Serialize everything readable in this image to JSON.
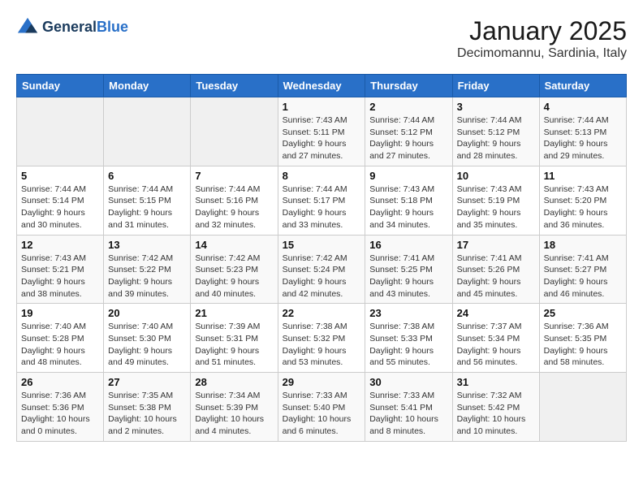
{
  "header": {
    "logo_line1": "General",
    "logo_line2": "Blue",
    "month": "January 2025",
    "location": "Decimomannu, Sardinia, Italy"
  },
  "weekdays": [
    "Sunday",
    "Monday",
    "Tuesday",
    "Wednesday",
    "Thursday",
    "Friday",
    "Saturday"
  ],
  "rows": [
    [
      {
        "day": "",
        "info": ""
      },
      {
        "day": "",
        "info": ""
      },
      {
        "day": "",
        "info": ""
      },
      {
        "day": "1",
        "info": "Sunrise: 7:43 AM\nSunset: 5:11 PM\nDaylight: 9 hours and 27 minutes."
      },
      {
        "day": "2",
        "info": "Sunrise: 7:44 AM\nSunset: 5:12 PM\nDaylight: 9 hours and 27 minutes."
      },
      {
        "day": "3",
        "info": "Sunrise: 7:44 AM\nSunset: 5:12 PM\nDaylight: 9 hours and 28 minutes."
      },
      {
        "day": "4",
        "info": "Sunrise: 7:44 AM\nSunset: 5:13 PM\nDaylight: 9 hours and 29 minutes."
      }
    ],
    [
      {
        "day": "5",
        "info": "Sunrise: 7:44 AM\nSunset: 5:14 PM\nDaylight: 9 hours and 30 minutes."
      },
      {
        "day": "6",
        "info": "Sunrise: 7:44 AM\nSunset: 5:15 PM\nDaylight: 9 hours and 31 minutes."
      },
      {
        "day": "7",
        "info": "Sunrise: 7:44 AM\nSunset: 5:16 PM\nDaylight: 9 hours and 32 minutes."
      },
      {
        "day": "8",
        "info": "Sunrise: 7:44 AM\nSunset: 5:17 PM\nDaylight: 9 hours and 33 minutes."
      },
      {
        "day": "9",
        "info": "Sunrise: 7:43 AM\nSunset: 5:18 PM\nDaylight: 9 hours and 34 minutes."
      },
      {
        "day": "10",
        "info": "Sunrise: 7:43 AM\nSunset: 5:19 PM\nDaylight: 9 hours and 35 minutes."
      },
      {
        "day": "11",
        "info": "Sunrise: 7:43 AM\nSunset: 5:20 PM\nDaylight: 9 hours and 36 minutes."
      }
    ],
    [
      {
        "day": "12",
        "info": "Sunrise: 7:43 AM\nSunset: 5:21 PM\nDaylight: 9 hours and 38 minutes."
      },
      {
        "day": "13",
        "info": "Sunrise: 7:42 AM\nSunset: 5:22 PM\nDaylight: 9 hours and 39 minutes."
      },
      {
        "day": "14",
        "info": "Sunrise: 7:42 AM\nSunset: 5:23 PM\nDaylight: 9 hours and 40 minutes."
      },
      {
        "day": "15",
        "info": "Sunrise: 7:42 AM\nSunset: 5:24 PM\nDaylight: 9 hours and 42 minutes."
      },
      {
        "day": "16",
        "info": "Sunrise: 7:41 AM\nSunset: 5:25 PM\nDaylight: 9 hours and 43 minutes."
      },
      {
        "day": "17",
        "info": "Sunrise: 7:41 AM\nSunset: 5:26 PM\nDaylight: 9 hours and 45 minutes."
      },
      {
        "day": "18",
        "info": "Sunrise: 7:41 AM\nSunset: 5:27 PM\nDaylight: 9 hours and 46 minutes."
      }
    ],
    [
      {
        "day": "19",
        "info": "Sunrise: 7:40 AM\nSunset: 5:28 PM\nDaylight: 9 hours and 48 minutes."
      },
      {
        "day": "20",
        "info": "Sunrise: 7:40 AM\nSunset: 5:30 PM\nDaylight: 9 hours and 49 minutes."
      },
      {
        "day": "21",
        "info": "Sunrise: 7:39 AM\nSunset: 5:31 PM\nDaylight: 9 hours and 51 minutes."
      },
      {
        "day": "22",
        "info": "Sunrise: 7:38 AM\nSunset: 5:32 PM\nDaylight: 9 hours and 53 minutes."
      },
      {
        "day": "23",
        "info": "Sunrise: 7:38 AM\nSunset: 5:33 PM\nDaylight: 9 hours and 55 minutes."
      },
      {
        "day": "24",
        "info": "Sunrise: 7:37 AM\nSunset: 5:34 PM\nDaylight: 9 hours and 56 minutes."
      },
      {
        "day": "25",
        "info": "Sunrise: 7:36 AM\nSunset: 5:35 PM\nDaylight: 9 hours and 58 minutes."
      }
    ],
    [
      {
        "day": "26",
        "info": "Sunrise: 7:36 AM\nSunset: 5:36 PM\nDaylight: 10 hours and 0 minutes."
      },
      {
        "day": "27",
        "info": "Sunrise: 7:35 AM\nSunset: 5:38 PM\nDaylight: 10 hours and 2 minutes."
      },
      {
        "day": "28",
        "info": "Sunrise: 7:34 AM\nSunset: 5:39 PM\nDaylight: 10 hours and 4 minutes."
      },
      {
        "day": "29",
        "info": "Sunrise: 7:33 AM\nSunset: 5:40 PM\nDaylight: 10 hours and 6 minutes."
      },
      {
        "day": "30",
        "info": "Sunrise: 7:33 AM\nSunset: 5:41 PM\nDaylight: 10 hours and 8 minutes."
      },
      {
        "day": "31",
        "info": "Sunrise: 7:32 AM\nSunset: 5:42 PM\nDaylight: 10 hours and 10 minutes."
      },
      {
        "day": "",
        "info": ""
      }
    ]
  ]
}
